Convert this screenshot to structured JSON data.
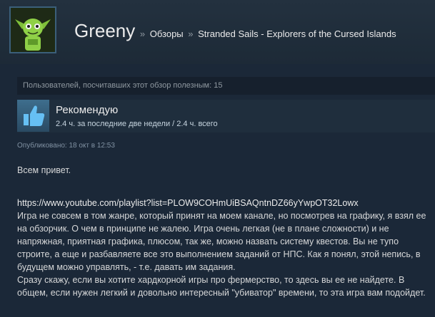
{
  "header": {
    "persona_name": "Greeny",
    "separator": "»",
    "crumb_reviews": "Обзоры",
    "crumb_game": "Stranded Sails - Explorers of the Cursed Islands"
  },
  "helpful_text": "Пользователей, посчитавших этот обзор полезным: 15",
  "recommendation": {
    "title": "Рекомендую",
    "hours": "2.4 ч. за последние две недели / 2.4 ч. всего"
  },
  "posted": "Опубликовано: 18 окт в 12:53",
  "review": {
    "greeting": "Всем привет.",
    "link": "https://www.youtube.com/playlist?list=PLOW9COHmUiBSAQntnDZ66yYwpOT32Lowx",
    "para1": "Игра не совсем в том жанре, который принят на моем канале, но посмотрев на графику, я взял ее на обзорчик. О чем в принципе не жалею. Игра очень легкая (не в плане сложности) и не напряжная, приятная графика, плюсом, так же, можно назвать систему квестов. Вы не тупо строите, а еще и разбавляете все это выполнением заданий от НПС. Как я понял, этой непись, в будущем можно управлять, - т.е. давать им задания.",
    "para2": "Сразу скажу, если вы хотите хардкорной игры про фермерство, то здесь вы ее не найдете. В общем, если нужен легкий и довольно интересный \"убиватор\" времени, то эта игра вам подойдет."
  },
  "colors": {
    "background": "#1b2838",
    "thumb_up": "#66c0f4"
  }
}
